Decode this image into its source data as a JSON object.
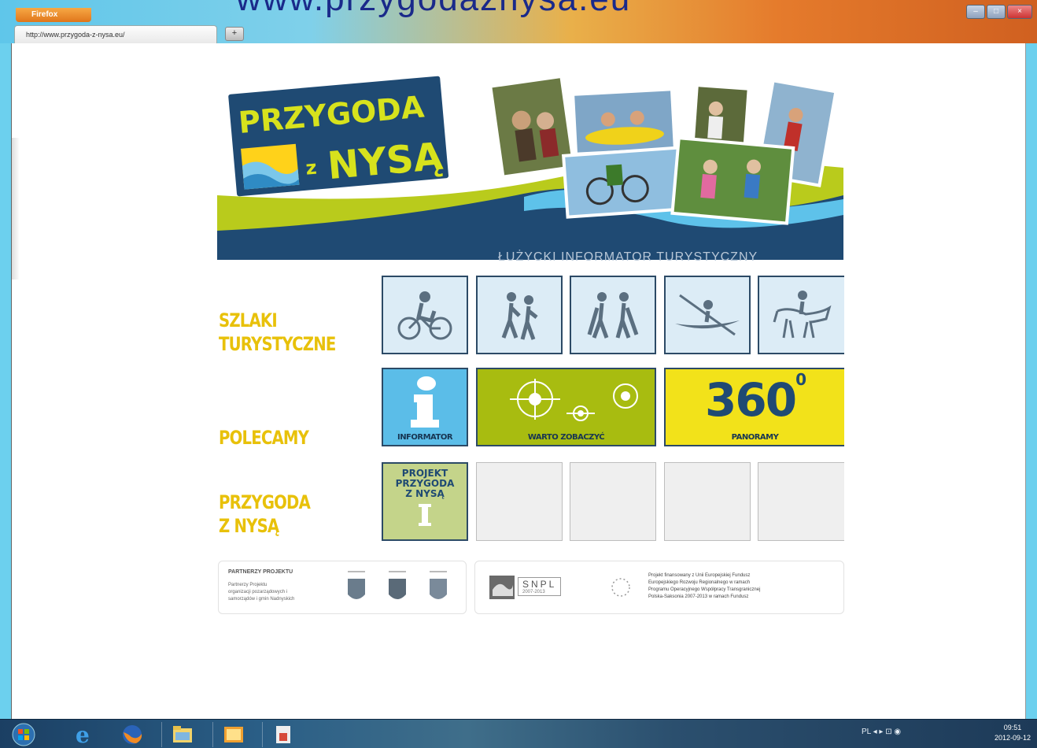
{
  "browser": {
    "menu_label": "Firefox",
    "tab_title": "http://www.przygoda-z-nysa.eu/",
    "new_tab_label": "+",
    "overlay_url": "www.przygodaznysa.eu",
    "window_controls": [
      "–",
      "□",
      "×"
    ]
  },
  "banner": {
    "logo_line1": "PRZYGODA",
    "logo_line2_small": "z",
    "logo_line2_big": "NYSĄ",
    "tagline": "ŁUŻYCKI INFORMATOR TURYSTYCZNY"
  },
  "sections": {
    "trails_label_line1": "SZLAKI",
    "trails_label_line2": "TURYSTYCZNE",
    "recommend_label": "POLECAMY",
    "project_label_line1": "PRZYGODA",
    "project_label_line2": "Z NYSĄ"
  },
  "trail_tiles": [
    {
      "icon": "cyclist-icon"
    },
    {
      "icon": "hikers-icon"
    },
    {
      "icon": "nordic-walking-icon"
    },
    {
      "icon": "kayak-icon"
    },
    {
      "icon": "horse-rider-icon"
    }
  ],
  "recommend_tiles": [
    {
      "caption": "INFORMATOR",
      "icon": "info-icon",
      "color": "#5bbde8"
    },
    {
      "caption": "WARTO ZOBACZYĆ",
      "icon": "target-icon",
      "color": "#a8bc10"
    },
    {
      "caption": "PANORAMY",
      "icon": "panorama-360-icon",
      "color": "#f2e21a",
      "big_text": "360",
      "degree": "0"
    }
  ],
  "project_tile": {
    "line1": "PROJEKT",
    "line2": "PRZYGODA",
    "line3": "Z NYSĄ",
    "color": "#c4d48a"
  },
  "sponsors": {
    "left_heading": "PARTNERZY PROJEKTU",
    "left_small": [
      "Partnerzy Projektu",
      "organizacji pozarządowych i",
      "samorządów i gmin Nadnyskich"
    ],
    "snpl_label": "SNPL",
    "snpl_sub": "2007-2013",
    "eu_text": [
      "Projekt finansowany z Unii Europejskiej Fundusz",
      "Europejskiego Rozwoju Regionalnego w ramach",
      "Programu Operacyjnego Współpracy Transgranicznej",
      "Polska-Saksonia 2007-2013 w ramach Fundusz"
    ]
  },
  "taskbar": {
    "tray_text": "PL  ◂  ▸  ⊡  ◉",
    "clock_time": "09:51",
    "clock_date": "2012-09-12"
  },
  "colors": {
    "accent_yellow": "#e8c10a",
    "dark_navy": "#173552",
    "sky_blue": "#5bbde8",
    "lime": "#a8bc10"
  }
}
